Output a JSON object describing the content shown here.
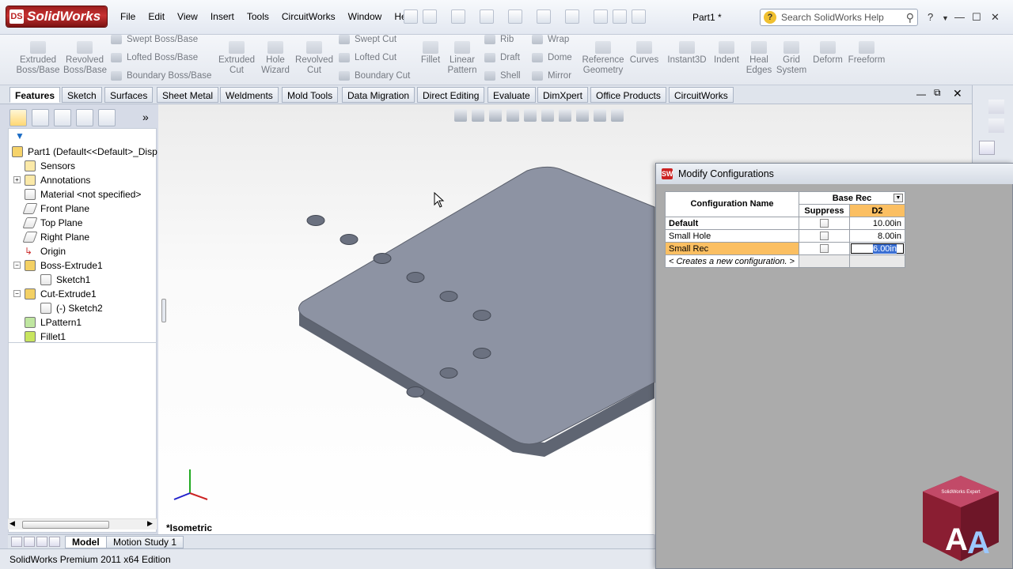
{
  "app": {
    "title": "SolidWorks",
    "document_title": "Part1 *"
  },
  "menu": [
    "File",
    "Edit",
    "View",
    "Insert",
    "Tools",
    "CircuitWorks",
    "Window",
    "Help"
  ],
  "search": {
    "placeholder": "Search SolidWorks Help"
  },
  "ribbon": {
    "large": [
      {
        "name": "extruded-boss",
        "label": "Extruded Boss/Base"
      },
      {
        "name": "revolved-boss",
        "label": "Revolved Boss/Base"
      },
      {
        "name": "extruded-cut",
        "label": "Extruded Cut"
      },
      {
        "name": "hole-wizard",
        "label": "Hole Wizard"
      },
      {
        "name": "revolved-cut",
        "label": "Revolved Cut"
      },
      {
        "name": "fillet",
        "label": "Fillet"
      },
      {
        "name": "linear-pattern",
        "label": "Linear Pattern"
      },
      {
        "name": "reference-geometry",
        "label": "Reference Geometry"
      },
      {
        "name": "curves",
        "label": "Curves"
      },
      {
        "name": "instant3d",
        "label": "Instant3D"
      },
      {
        "name": "indent",
        "label": "Indent"
      },
      {
        "name": "heal-edges",
        "label": "Heal Edges"
      },
      {
        "name": "grid-system",
        "label": "Grid System"
      },
      {
        "name": "deform",
        "label": "Deform"
      },
      {
        "name": "freeform",
        "label": "Freeform"
      }
    ],
    "small": [
      {
        "name": "swept-boss",
        "label": "Swept Boss/Base"
      },
      {
        "name": "lofted-boss",
        "label": "Lofted Boss/Base"
      },
      {
        "name": "boundary-boss",
        "label": "Boundary Boss/Base"
      },
      {
        "name": "swept-cut",
        "label": "Swept Cut"
      },
      {
        "name": "lofted-cut",
        "label": "Lofted Cut"
      },
      {
        "name": "boundary-cut",
        "label": "Boundary Cut"
      },
      {
        "name": "rib",
        "label": "Rib"
      },
      {
        "name": "draft",
        "label": "Draft"
      },
      {
        "name": "shell",
        "label": "Shell"
      },
      {
        "name": "wrap",
        "label": "Wrap"
      },
      {
        "name": "dome",
        "label": "Dome"
      },
      {
        "name": "mirror",
        "label": "Mirror"
      }
    ]
  },
  "tabs": [
    "Features",
    "Sketch",
    "Surfaces",
    "Sheet Metal",
    "Weldments",
    "Mold Tools",
    "Data Migration",
    "Direct Editing",
    "Evaluate",
    "DimXpert",
    "Office Products",
    "CircuitWorks"
  ],
  "tree": [
    "Part1  (Default<<Default>_Disp",
    "Sensors",
    "Annotations",
    "Material <not specified>",
    "Front Plane",
    "Top Plane",
    "Right Plane",
    "Origin",
    "Boss-Extrude1",
    "Sketch1",
    "Cut-Extrude1",
    "(-) Sketch2",
    "LPattern1",
    "Fillet1"
  ],
  "viewport": {
    "view_label": "*Isometric"
  },
  "bottom_tabs": [
    "Model",
    "Motion Study 1"
  ],
  "status": "SolidWorks Premium 2011 x64 Edition",
  "dialog": {
    "title": "Modify Configurations",
    "header_config": "Configuration Name",
    "header_group": "Base Rec",
    "header_suppress": "Suppress",
    "header_d2": "D2",
    "rows": [
      {
        "name": "Default",
        "d2": "10.00in"
      },
      {
        "name": "Small Hole",
        "d2": "8.00in"
      },
      {
        "name": "Small Rec",
        "d2": "6.00in"
      }
    ],
    "new_row": "< Creates a new configuration. >"
  },
  "badge_text": "SolidWorks Expert",
  "colors": {
    "accent_orange": "#fbbf62",
    "plate": "#8d93a3"
  }
}
